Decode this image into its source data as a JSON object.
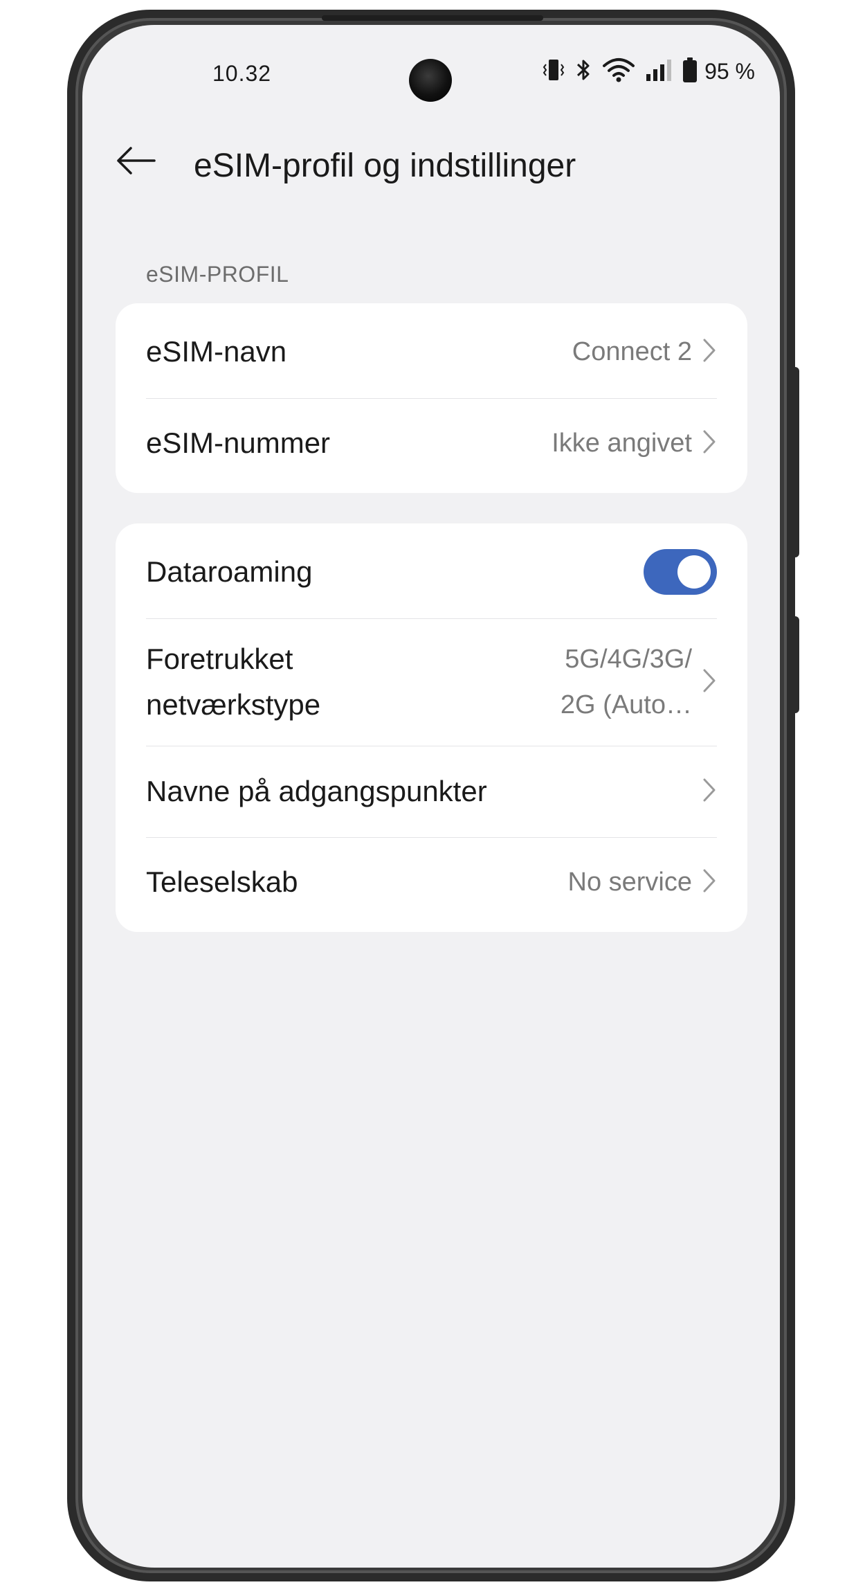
{
  "status_bar": {
    "time": "10.32",
    "battery_percent": "95 %",
    "icons": [
      "vibrate-icon",
      "bluetooth-icon",
      "wifi-icon",
      "signal-icon",
      "battery-icon"
    ]
  },
  "header": {
    "title": "eSIM-profil og indstillinger",
    "back_icon": "arrow-left-icon"
  },
  "section_profile": {
    "label": "eSIM-PROFIL",
    "items": [
      {
        "label": "eSIM-navn",
        "value": "Connect 2"
      },
      {
        "label": "eSIM-nummer",
        "value": "Ikke angivet"
      }
    ]
  },
  "section_settings": {
    "data_roaming": {
      "label": "Dataroaming",
      "enabled": true
    },
    "network_type": {
      "label_line1": "Foretrukket",
      "label_line2": "netværkstype",
      "value_line1": "5G/4G/3G/",
      "value_line2": "2G (Auto…"
    },
    "apn": {
      "label": "Navne på adgangspunkter"
    },
    "carrier": {
      "label": "Teleselskab",
      "value": "No service"
    }
  },
  "colors": {
    "accent": "#3d67bd",
    "background": "#f1f1f3",
    "card": "#ffffff",
    "text_primary": "#1a1a1a",
    "text_secondary": "#7a7a7a"
  }
}
